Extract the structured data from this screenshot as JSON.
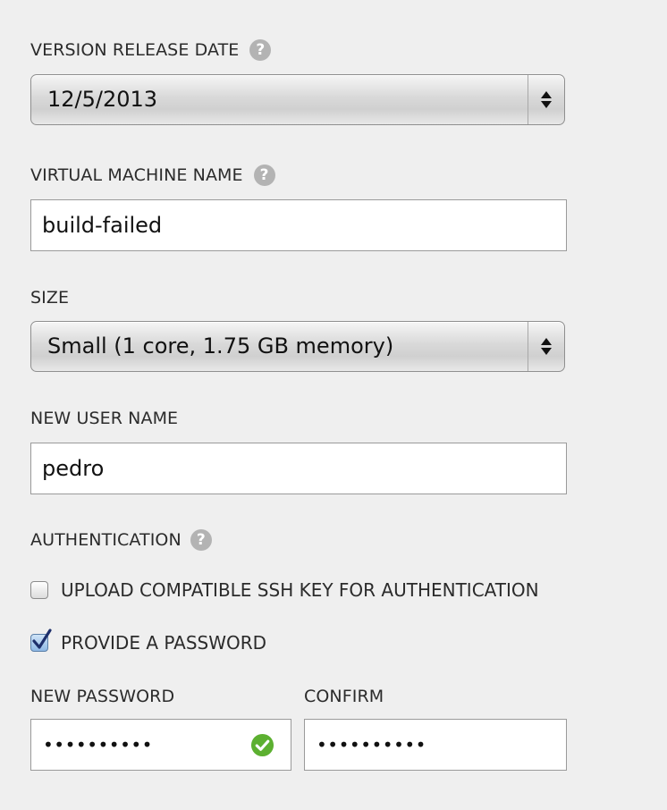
{
  "form": {
    "version_release_date": {
      "label": "VERSION RELEASE DATE",
      "help_icon": "?",
      "value": "12/5/2013"
    },
    "virtual_machine_name": {
      "label": "VIRTUAL MACHINE NAME",
      "help_icon": "?",
      "value": "build-failed"
    },
    "size": {
      "label": "SIZE",
      "value": "Small (1 core, 1.75 GB memory)"
    },
    "new_user_name": {
      "label": "NEW USER NAME",
      "value": "pedro"
    },
    "authentication": {
      "label": "AUTHENTICATION",
      "help_icon": "?",
      "options": [
        {
          "label": "UPLOAD COMPATIBLE SSH KEY FOR AUTHENTICATION",
          "checked": false
        },
        {
          "label": "PROVIDE A PASSWORD",
          "checked": true
        }
      ]
    },
    "new_password": {
      "label": "NEW PASSWORD",
      "masked_value": "••••••••••",
      "status_icon": "check-circle-icon",
      "status_color": "#5cb030"
    },
    "confirm": {
      "label": "CONFIRM",
      "masked_value": "••••••••••"
    }
  },
  "colors": {
    "background": "#efefef",
    "checkbox_checked": "#8fb9e6",
    "help_icon": "#b3b3b3",
    "valid_green": "#5cb030"
  }
}
